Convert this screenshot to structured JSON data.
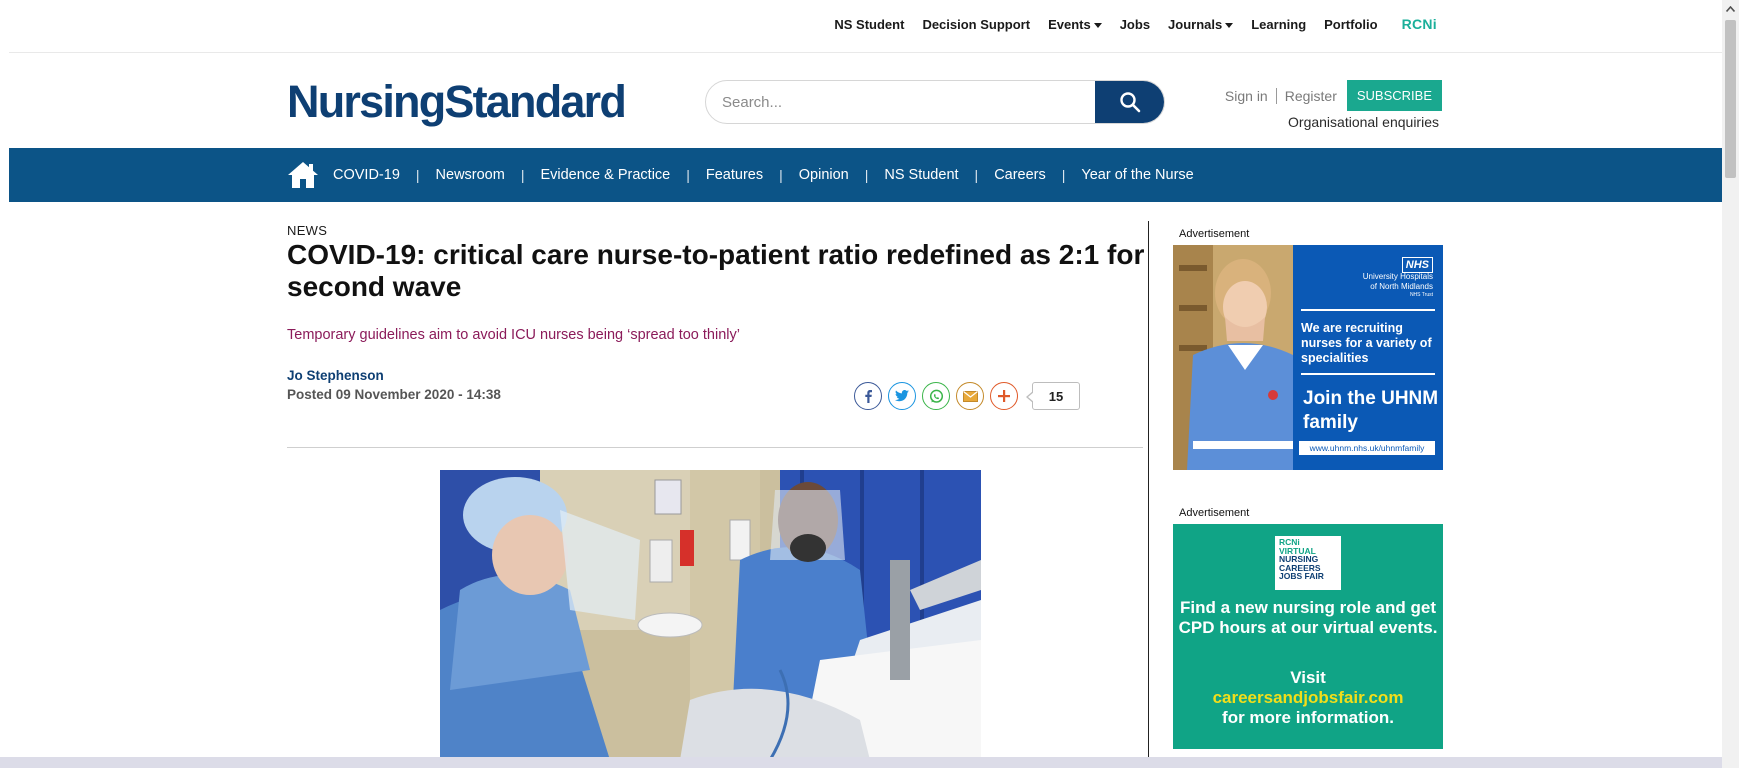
{
  "top_links": [
    {
      "label": "NS Student",
      "caret": false
    },
    {
      "label": "Decision Support",
      "caret": false
    },
    {
      "label": "Events",
      "caret": true
    },
    {
      "label": "Jobs",
      "caret": false
    },
    {
      "label": "Journals",
      "caret": true
    },
    {
      "label": "Learning",
      "caret": false
    },
    {
      "label": "Portfolio",
      "caret": false
    }
  ],
  "brand_link": "RCNi",
  "logo_text": "NursingStandard",
  "search": {
    "placeholder": "Search..."
  },
  "account": {
    "sign_in": "Sign in",
    "register": "Register",
    "subscribe": "SUBSCRIBE",
    "org_enquiries": "Organisational enquiries"
  },
  "nav_items": [
    "COVID-19",
    "Newsroom",
    "Evidence & Practice",
    "Features",
    "Opinion",
    "NS Student",
    "Careers",
    "Year of the Nurse"
  ],
  "article": {
    "kicker": "NEWS",
    "headline": "COVID-19: critical care nurse-to-patient ratio redefined as 2:1 for second wave",
    "standfirst": "Temporary guidelines aim to avoid ICU nurses being ‘spread too thinly’",
    "author": "Jo Stephenson",
    "posted": "Posted 09 November 2020 - 14:38",
    "share_count": "15"
  },
  "ads": {
    "label": "Advertisement",
    "ad1": {
      "nhs": "NHS",
      "trust_line1": "University Hospitals",
      "trust_line2": "of North Midlands",
      "trust_line3": "NHS Trust",
      "recruit": "We are recruiting nurses for a variety of specialities",
      "join": "Join the UHNM family",
      "url": "www.uhnm.nhs.uk/uhnmfamily"
    },
    "ad2": {
      "logo_line1": "RCNi",
      "logo_line2": "VIRTUAL",
      "logo_line3": "NURSING",
      "logo_line4": "CAREERS",
      "logo_line5": "JOBS FAIR",
      "text": "Find a new nursing role and get CPD hours at our virtual events.",
      "visit": "Visit",
      "url": "careersandjobsfair.com",
      "more": "for more information."
    }
  },
  "colors": {
    "brand_navy": "#0e3f73",
    "nav_blue": "#0c5487",
    "subscribe_green": "#1aa88f",
    "standfirst_plum": "#8b1b5a",
    "rcni_teal": "#1aaf9a"
  }
}
